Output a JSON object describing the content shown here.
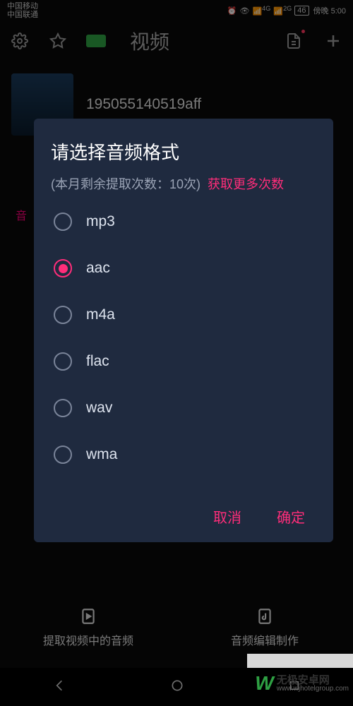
{
  "status": {
    "carrier1": "中国移动",
    "carrier2": "中国联通",
    "sig1": "4G",
    "sig2": "2G",
    "battery": "46",
    "time": "傍晚 5:00"
  },
  "toolbar": {
    "title": "视频"
  },
  "file": {
    "name": "195055140519aff"
  },
  "tab_hint": "音",
  "modal": {
    "title": "请选择音频格式",
    "subtitle": "(本月剩余提取次数：10次)",
    "link": "获取更多次数",
    "options": [
      {
        "label": "mp3",
        "selected": false
      },
      {
        "label": "aac",
        "selected": true
      },
      {
        "label": "m4a",
        "selected": false
      },
      {
        "label": "flac",
        "selected": false
      },
      {
        "label": "wav",
        "selected": false
      },
      {
        "label": "wma",
        "selected": false
      }
    ],
    "cancel": "取消",
    "confirm": "确定"
  },
  "bottom_nav": {
    "extract": "提取视频中的音频",
    "edit": "音频编辑制作"
  },
  "watermark": {
    "brand": "无极安卓网",
    "url": "www.wjhotelgroup.com"
  }
}
